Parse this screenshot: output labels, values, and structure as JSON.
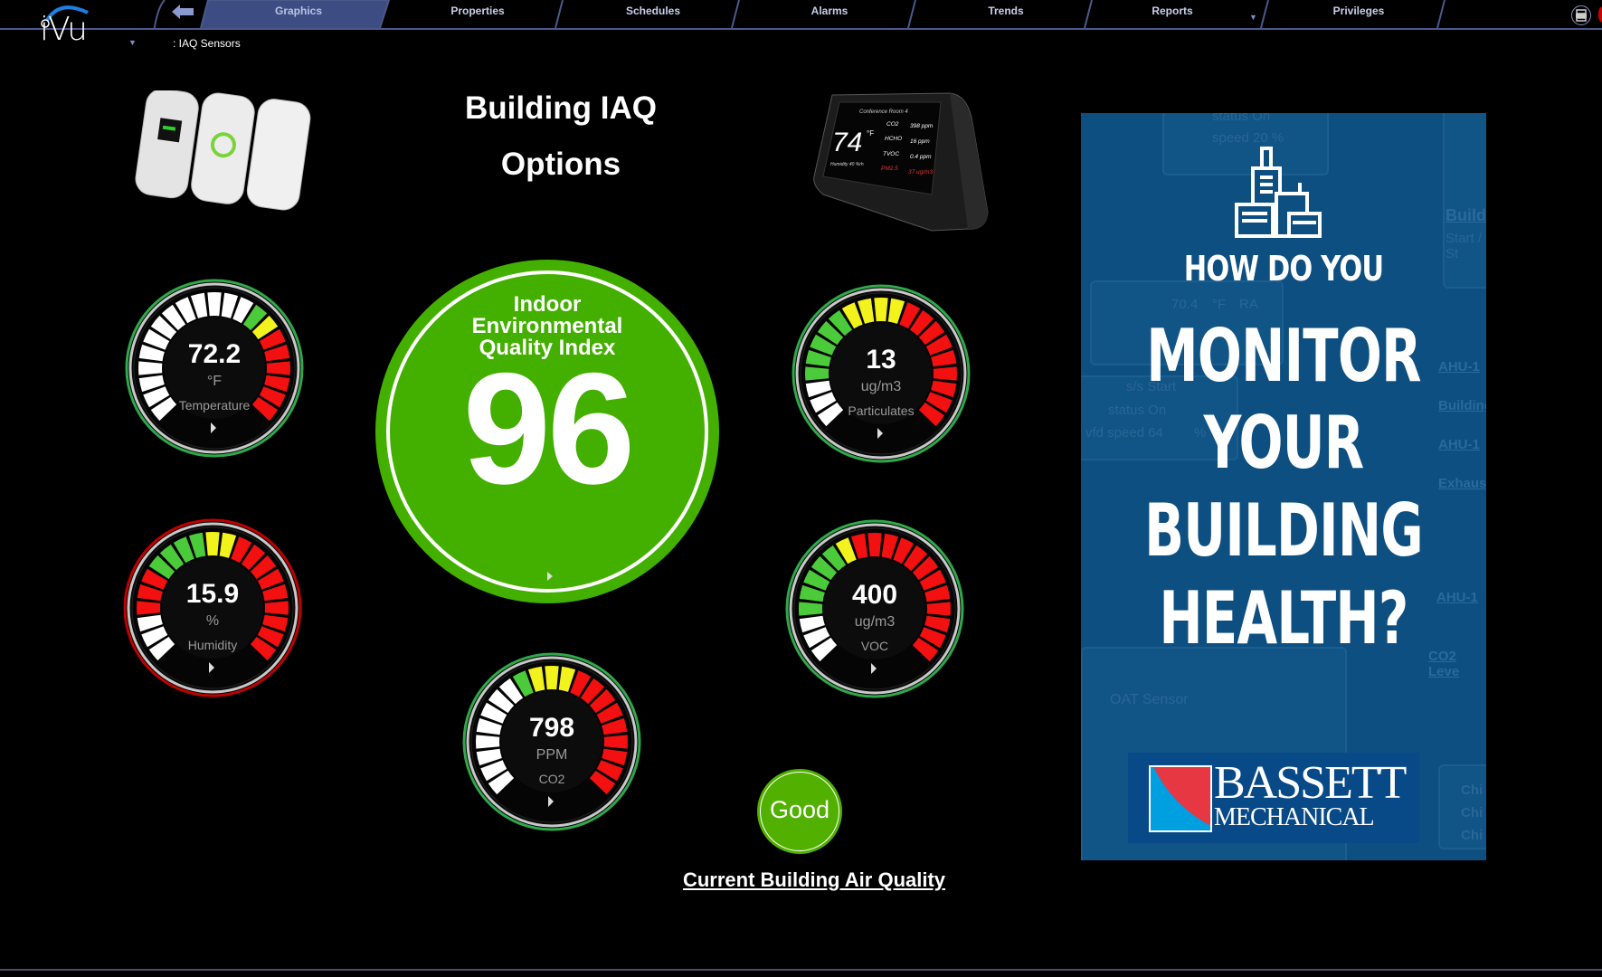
{
  "app": {
    "logo_text": "iVu",
    "breadcrumb": ": IAQ Sensors"
  },
  "nav": {
    "tabs": [
      {
        "label": "Graphics",
        "active": true
      },
      {
        "label": "Properties",
        "active": false
      },
      {
        "label": "Schedules",
        "active": false
      },
      {
        "label": "Alarms",
        "active": false
      },
      {
        "label": "Trends",
        "active": false
      },
      {
        "label": "Reports",
        "active": false
      },
      {
        "label": "Privileges",
        "active": false
      }
    ]
  },
  "page": {
    "title_line1": "Building IAQ",
    "title_line2": "Options"
  },
  "ieq": {
    "label_line1": "Indoor",
    "label_line2": "Environmental",
    "label_line3": "Quality Index",
    "value": "96",
    "color": "#43b000"
  },
  "gauges": {
    "temperature": {
      "value": "72.2",
      "unit": "°F",
      "label": "Temperature",
      "ring_color": "#2fa84a",
      "segments": [
        "w",
        "w",
        "w",
        "w",
        "w",
        "w",
        "w",
        "w",
        "w",
        "w",
        "w",
        "w",
        "w",
        "g",
        "y",
        "r",
        "r",
        "r",
        "r",
        "r",
        "r"
      ]
    },
    "humidity": {
      "value": "15.9",
      "unit": "%",
      "label": "Humidity",
      "ring_color": "#c00000",
      "segments": [
        "w",
        "w",
        "w",
        "r",
        "r",
        "r",
        "g",
        "g",
        "g",
        "g",
        "y",
        "y",
        "r",
        "r",
        "r",
        "r",
        "r",
        "r",
        "r",
        "r",
        "r"
      ]
    },
    "co2": {
      "value": "798",
      "unit": "PPM",
      "label": "CO2",
      "ring_color": "#2fa84a",
      "segments": [
        "w",
        "w",
        "w",
        "w",
        "w",
        "w",
        "w",
        "w",
        "g",
        "y",
        "y",
        "y",
        "r",
        "r",
        "r",
        "r",
        "r",
        "r",
        "r",
        "r",
        "r"
      ]
    },
    "particulates": {
      "value": "13",
      "unit": "ug/m3",
      "label": "Particulates",
      "ring_color": "#2fa84a",
      "segments": [
        "w",
        "w",
        "w",
        "g",
        "g",
        "g",
        "g",
        "g",
        "y",
        "y",
        "y",
        "y",
        "r",
        "r",
        "r",
        "r",
        "r",
        "r",
        "r",
        "r",
        "r"
      ]
    },
    "voc": {
      "value": "400",
      "unit": "ug/m3",
      "label": "VOC",
      "ring_color": "#2fa84a",
      "segments": [
        "w",
        "w",
        "w",
        "g",
        "g",
        "g",
        "g",
        "g",
        "y",
        "r",
        "r",
        "r",
        "r",
        "r",
        "r",
        "r",
        "r",
        "r",
        "r",
        "r",
        "r"
      ]
    }
  },
  "status": {
    "badge": "Good",
    "badge_color": "#52b000",
    "link": "Current Building Air Quality"
  },
  "ad": {
    "line1": "HOW DO YOU",
    "line2": "MONITOR",
    "line3": "YOUR",
    "line4": "BUILDING",
    "line5": "HEALTH?",
    "brand_line1": "BASSETT",
    "brand_line2": "MECHANICAL",
    "bg_texts": [
      "status  On",
      "speed  20  %",
      "70.4",
      "°F",
      "RA",
      "s/s  Start",
      "status  On",
      "vfd speed  64",
      "%",
      "OAT Sensor",
      "Start / St"
    ],
    "bg_links": [
      "Build",
      "AHU-1",
      "Building",
      "AHU-1",
      "Exhaus",
      "AHU-1",
      "CO2 Leve",
      "Chi",
      "Chi",
      "Chi"
    ]
  },
  "devices": {
    "monitor_room": "Conference Room 4",
    "monitor_temp": "74",
    "monitor_temp_unit": "°F",
    "monitor_humidity": "Humidity  40 %rh",
    "monitor_rows": [
      {
        "name": "CO2",
        "value": "398 ppm"
      },
      {
        "name": "HCHO",
        "value": "16 ppm"
      },
      {
        "name": "TVOC",
        "value": "0.4 ppm"
      },
      {
        "name": "PM2.5",
        "value": "37 ug/m3"
      }
    ]
  }
}
